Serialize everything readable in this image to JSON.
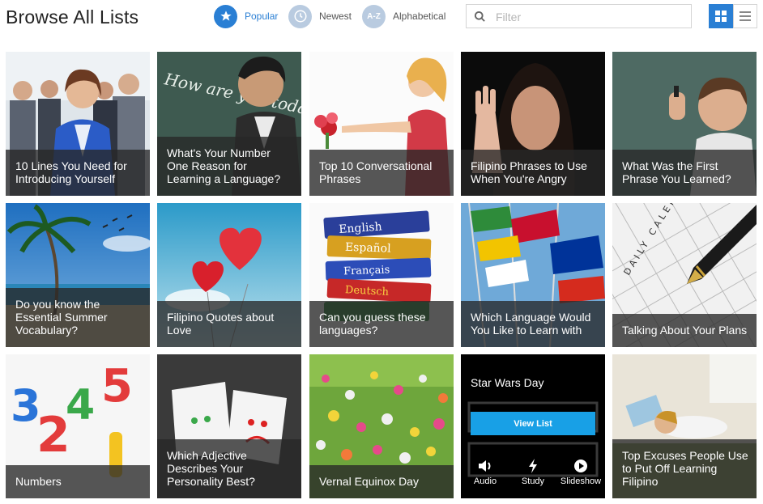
{
  "header": {
    "title": "Browse All Lists",
    "sort_options": [
      {
        "label": "Popular",
        "badge": "★",
        "active": true
      },
      {
        "label": "Newest",
        "badge": "clock-icon",
        "active": false
      },
      {
        "label": "Alphabetical",
        "badge": "A-Z",
        "active": false
      }
    ],
    "filter_placeholder": "Filter",
    "view_modes": [
      "grid",
      "list"
    ],
    "active_view": "grid"
  },
  "colors": {
    "accent": "#2a7fd4",
    "inactive_badge": "#b9cbe0",
    "view_list_button": "#18a0e6"
  },
  "tiles": [
    {
      "caption": "10 Lines You Need for Introducing Yourself"
    },
    {
      "caption": "What's Your Number One Reason for Learning a Language?"
    },
    {
      "caption": "Top 10 Conversational Phrases"
    },
    {
      "caption": "Filipino Phrases to Use When You're Angry"
    },
    {
      "caption": "What Was the First Phrase You Learned?"
    },
    {
      "caption": "Do you know the Essential Summer Vocabulary?"
    },
    {
      "caption": "Filipino Quotes about Love"
    },
    {
      "caption": "Can you guess these languages?"
    },
    {
      "caption": "Which Language Would You Like to Learn with"
    },
    {
      "caption": "Talking About Your Plans"
    },
    {
      "caption": "Numbers"
    },
    {
      "caption": "Which Adjective Describes Your Personality Best?"
    },
    {
      "caption": "Vernal Equinox Day"
    },
    {
      "caption": "Star Wars Day"
    },
    {
      "caption": "Top Excuses People Use to Put Off Learning Filipino"
    }
  ],
  "active_tile": {
    "title": "Star Wars Day",
    "view_button": "View List",
    "actions": [
      {
        "label": "Audio",
        "icon": "speaker-icon"
      },
      {
        "label": "Study",
        "icon": "lightning-icon"
      },
      {
        "label": "Slideshow",
        "icon": "play-icon"
      }
    ]
  },
  "book_labels": [
    "English",
    "Español",
    "Français",
    "Deutsch"
  ],
  "calendar_text": "DAILY CALENDAR",
  "chalkboard_text": "How are you today! I'm fine"
}
